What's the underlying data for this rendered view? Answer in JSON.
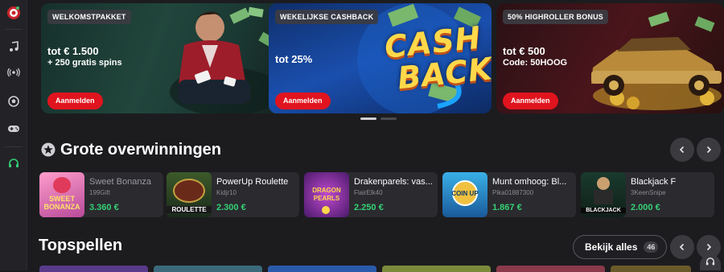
{
  "sidebar": {
    "items": [
      {
        "icon": "roulette-icon"
      },
      {
        "icon": "music-note-icon"
      },
      {
        "icon": "live-broadcast-icon"
      },
      {
        "icon": "soccer-ball-icon"
      },
      {
        "icon": "gamepad-icon"
      },
      {
        "icon": "support-headset-icon"
      }
    ]
  },
  "banners": [
    {
      "tag": "WELKOMSTPAKKET",
      "line1": "tot € 1.500",
      "line2": "+ 250 gratis spins",
      "cta": "Aanmelden"
    },
    {
      "tag": "WEKELIJKSE CASHBACK",
      "line1": "tot 25%",
      "line2": "",
      "cta": "Aanmelden",
      "art_top": "CASH",
      "art_bottom": "BACK"
    },
    {
      "tag": "50% HIGHROLLER BONUS",
      "line1": "tot € 500",
      "line2": "Code: 50HOOG",
      "cta": "Aanmelden"
    }
  ],
  "carousel": {
    "active": 0
  },
  "big_wins": {
    "title": "Grote overwinningen",
    "cards": [
      {
        "title": "Sweet Bonanza",
        "user": "199Gift",
        "amount": "3.360 €",
        "thumb": "SWEET BONANZA",
        "color": "#c94a8a"
      },
      {
        "title": "PowerUp Roulette",
        "user": "Kidjr10",
        "amount": "2.300 €",
        "thumb": "ROULETTE",
        "color": "#2c4a2e"
      },
      {
        "title": "Drakenparels: vas...",
        "user": "FlairElk40",
        "amount": "2.250 €",
        "thumb": "DRAGON PEARLS",
        "color": "#8a3a9a"
      },
      {
        "title": "Munt omhoog: Bl...",
        "user": "Pika01887300",
        "amount": "1.867 €",
        "thumb": "COIN UP",
        "color": "#2a88c8"
      },
      {
        "title": "Blackjack F",
        "user": "3KeenSnipe",
        "amount": "2.000 €",
        "thumb": "BLACKJACK",
        "color": "#1f3a30"
      }
    ]
  },
  "top_games": {
    "title": "Topspellen",
    "see_all": "Bekijk alles",
    "count": "46"
  },
  "colors": {
    "accent_red": "#e0141e",
    "win_green": "#34d174",
    "bg": "#1c1c1f"
  }
}
